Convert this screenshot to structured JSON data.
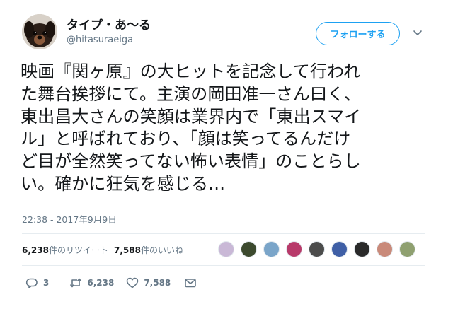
{
  "user": {
    "name": "タイプ・あ～る",
    "handle": "@hitasuraeiga"
  },
  "follow_button": {
    "label": "フォローする"
  },
  "tweet": {
    "text": "映画『関ヶ原』の大ヒットを記念して行われ\nた舞台挨拶にて。主演の岡田准一さん曰く、\n東出昌大さんの笑顔は業界内で「東出スマイ\nル」と呼ばれており、「顔は笑ってるんだけ\nど目が全然笑ってない怖い表情」のことらし\nい。確かに狂気を感じる…",
    "timestamp": "22:38 - 2017年9月9日"
  },
  "stats": {
    "retweet_count": "6,238",
    "retweet_label": "件のリツイート",
    "like_count": "7,588",
    "like_label": "件のいいね"
  },
  "likers": {
    "count_shown": 9,
    "colors": [
      "#c9b8d6",
      "#3c4a2e",
      "#7aa5c9",
      "#b83a6a",
      "#4c4c4c",
      "#3f5fa6",
      "#2a2a2a",
      "#c98a7a",
      "#8fa070"
    ]
  },
  "actions": {
    "reply_count": "3",
    "retweet_count": "6,238",
    "like_count": "7,588"
  },
  "icons": {
    "caret": "chevron-down-icon",
    "reply": "reply-icon",
    "retweet": "retweet-icon",
    "like": "heart-icon",
    "dm": "envelope-icon"
  },
  "colors": {
    "accent": "#1da1f2",
    "secondary_text": "#657786",
    "primary_text": "#14171a"
  }
}
